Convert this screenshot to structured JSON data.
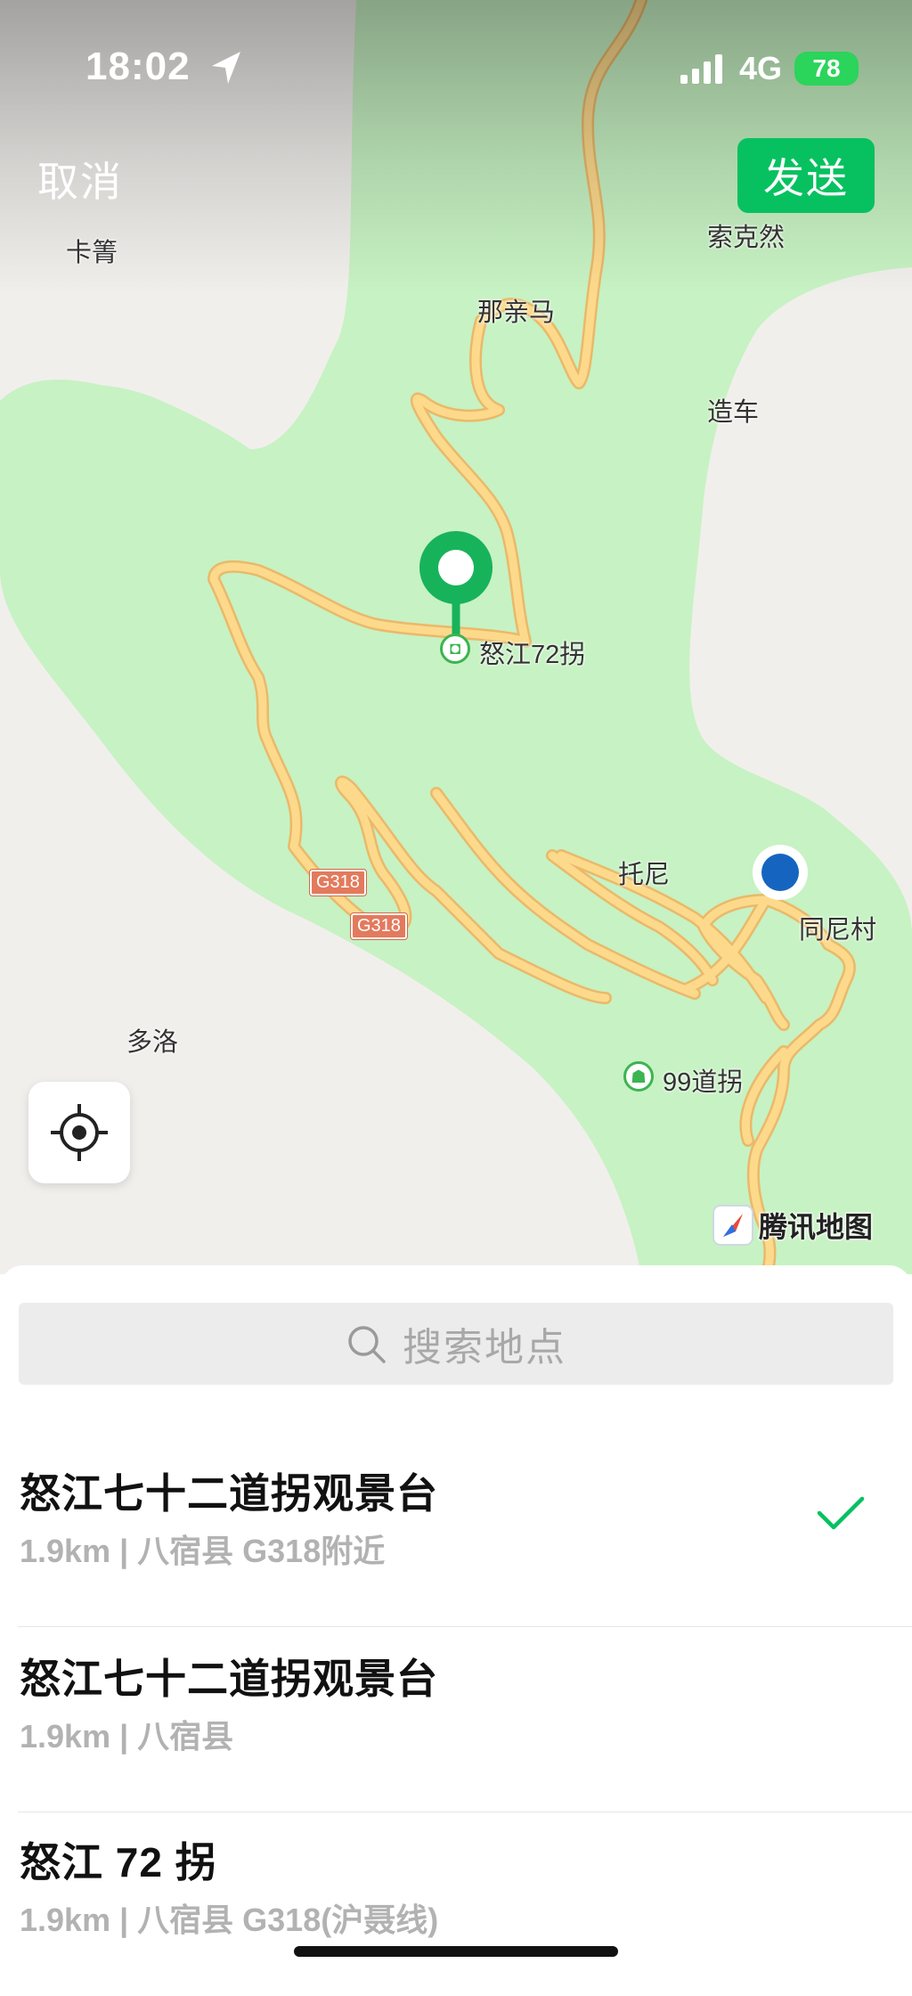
{
  "status_bar": {
    "time": "18:02",
    "network": "4G",
    "battery": "78"
  },
  "nav": {
    "cancel": "取消",
    "send": "发送"
  },
  "map": {
    "places": {
      "kajian": "卡箐",
      "suokeran": "索克然",
      "naqinma": "那亲马",
      "zaoche": "造车",
      "tuoni": "托尼",
      "tongnicun": "同尼村",
      "duoluo": "多洛"
    },
    "pois": {
      "nujiang72": "怒江72拐",
      "daoguai99": "99道拐"
    },
    "road_badges": [
      "G318",
      "G318"
    ],
    "logo": "腾讯地图",
    "colors": {
      "green_area": "#c7f2c3",
      "road": "#fdd98c",
      "pin": "#17b35a",
      "user_dot": "#1565c0"
    }
  },
  "search": {
    "placeholder": "搜索地点"
  },
  "results": [
    {
      "title": "怒江七十二道拐观景台",
      "subtitle": "1.9km | 八宿县 G318附近",
      "selected": true
    },
    {
      "title": "怒江七十二道拐观景台",
      "subtitle": "1.9km | 八宿县",
      "selected": false
    },
    {
      "title": "怒江 72 拐",
      "subtitle": "1.9km | 八宿县 G318(沪聂线)",
      "selected": false
    }
  ],
  "accent_color": "#07c160"
}
